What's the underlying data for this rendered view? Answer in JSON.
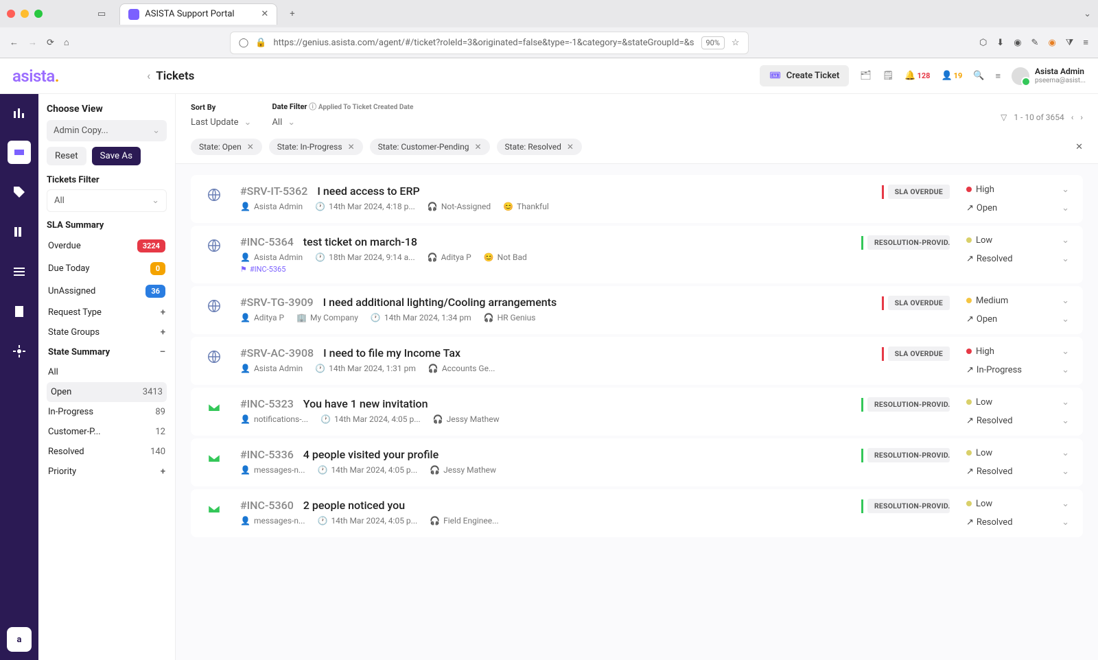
{
  "browser": {
    "tab_title": "ASISTA Support Portal",
    "url": "https://genius.asista.com/agent/#/ticket?roleId=3&originated=false&type=-1&category=&stateGroupId=&s",
    "zoom": "90%"
  },
  "header": {
    "page_title": "Tickets",
    "create_btn": "Create Ticket",
    "notif_count": "128",
    "assign_count": "19",
    "user_name": "Asista Admin",
    "user_email": "pseema@asist..."
  },
  "sort": {
    "sort_by_label": "Sort By",
    "sort_by_value": "Last Update",
    "date_filter_label": "Date Filter",
    "date_filter_value": "All",
    "date_filter_hint": "Applied To Ticket Created Date",
    "paging_text": "1 - 10 of 3654"
  },
  "chips": [
    "State: Open",
    "State: In-Progress",
    "State: Customer-Pending",
    "State: Resolved"
  ],
  "sidebar": {
    "choose_view_label": "Choose View",
    "view_value": "Admin Copy...",
    "reset": "Reset",
    "save_as": "Save As",
    "tickets_filter_label": "Tickets Filter",
    "tickets_filter_value": "All",
    "sla_label": "SLA Summary",
    "sla_items": [
      {
        "label": "Overdue",
        "count": "3224",
        "cls": "red"
      },
      {
        "label": "Due Today",
        "count": "0",
        "cls": "orange"
      },
      {
        "label": "UnAssigned",
        "count": "36",
        "cls": "blue"
      }
    ],
    "request_type": "Request Type",
    "state_groups": "State Groups",
    "state_summary": "State Summary",
    "states": [
      {
        "label": "All",
        "count": ""
      },
      {
        "label": "Open",
        "count": "3413"
      },
      {
        "label": "In-Progress",
        "count": "89"
      },
      {
        "label": "Customer-P...",
        "count": "12"
      },
      {
        "label": "Resolved",
        "count": "140"
      }
    ],
    "priority": "Priority"
  },
  "tickets": [
    {
      "icon": "web",
      "id": "#SRV-IT-5362",
      "title": "I need access to ERP",
      "owner": "Asista Admin",
      "date": "14th Mar 2024, 4:18 p...",
      "assignee": "Not-Assigned",
      "mood": "Thankful",
      "sla": "SLA OVERDUE",
      "sla_cls": "red",
      "priority": "High",
      "pcls": "red",
      "status": "Open"
    },
    {
      "icon": "web",
      "id": "#INC-5364",
      "title": "test ticket on march-18",
      "owner": "Asista Admin",
      "date": "18th Mar 2024, 9:14 a...",
      "assignee": "Aditya P",
      "mood": "Not Bad",
      "link": "#INC-5365",
      "sla": "RESOLUTION-PROVID...",
      "sla_cls": "green",
      "priority": "Low",
      "pcls": "low",
      "status": "Resolved"
    },
    {
      "icon": "web",
      "id": "#SRV-TG-3909",
      "title": "I need additional lighting/Cooling arrangements",
      "owner": "Aditya P",
      "company": "My Company",
      "date": "14th Mar 2024, 1:34 pm",
      "assignee": "HR Genius",
      "sla": "SLA OVERDUE",
      "sla_cls": "red",
      "priority": "Medium",
      "pcls": "yellow",
      "status": "Open"
    },
    {
      "icon": "web",
      "id": "#SRV-AC-3908",
      "title": "I need to file my Income Tax",
      "owner": "Asista Admin",
      "date": "14th Mar 2024, 1:31 pm",
      "assignee": "Accounts Ge...",
      "sla": "SLA OVERDUE",
      "sla_cls": "red",
      "priority": "High",
      "pcls": "red",
      "status": "In-Progress"
    },
    {
      "icon": "mail",
      "id": "#INC-5323",
      "title": "You have 1 new invitation",
      "owner": "notifications-...",
      "date": "14th Mar 2024, 4:05 p...",
      "assignee": "Jessy Mathew",
      "sla": "RESOLUTION-PROVID...",
      "sla_cls": "green",
      "priority": "Low",
      "pcls": "low",
      "status": "Resolved"
    },
    {
      "icon": "mail",
      "id": "#INC-5336",
      "title": "4 people visited your profile",
      "owner": "messages-n...",
      "date": "14th Mar 2024, 4:05 p...",
      "assignee": "Jessy Mathew",
      "sla": "RESOLUTION-PROVID...",
      "sla_cls": "green",
      "priority": "Low",
      "pcls": "low",
      "status": "Resolved"
    },
    {
      "icon": "mail",
      "id": "#INC-5360",
      "title": "2 people noticed you",
      "owner": "messages-n...",
      "date": "14th Mar 2024, 4:05 p...",
      "assignee": "Field Enginee...",
      "sla": "RESOLUTION-PROVID...",
      "sla_cls": "green",
      "priority": "Low",
      "pcls": "low",
      "status": "Resolved"
    }
  ]
}
